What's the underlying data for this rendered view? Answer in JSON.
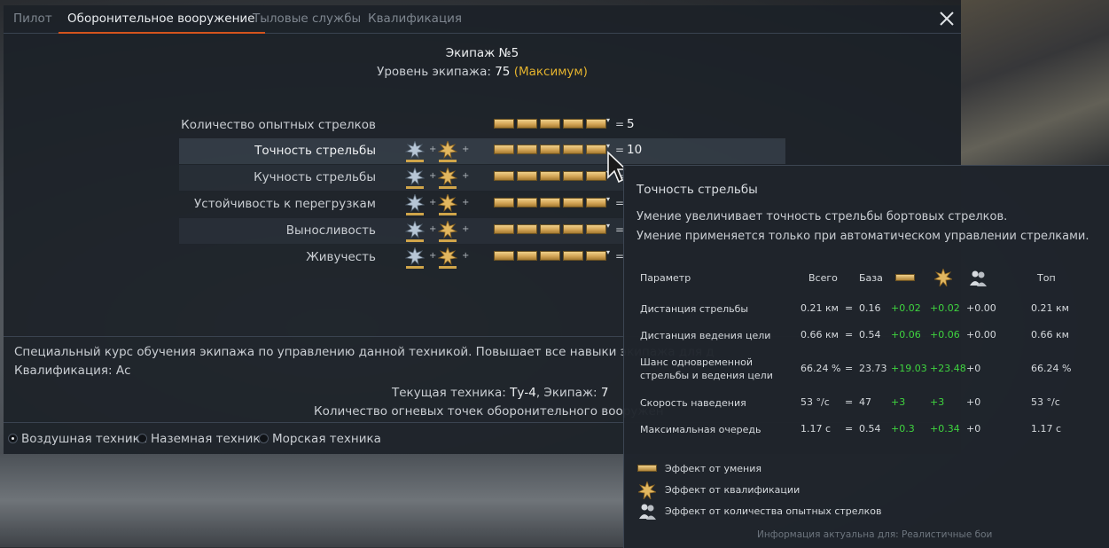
{
  "tabs": [
    {
      "label": "Пилот",
      "active": false
    },
    {
      "label": "Оборонительное вооружение",
      "active": true
    },
    {
      "label": "Тыловые службы",
      "active": false
    },
    {
      "label": "Квалификация",
      "active": false
    }
  ],
  "crew": {
    "title": "Экипаж №5",
    "level_prefix": "Уровень экипажа: ",
    "level_value": "75",
    "level_max": "(Максимум)"
  },
  "skills": [
    {
      "name": "Количество опытных стрелков",
      "value": "5",
      "badges": false,
      "filled": 5
    },
    {
      "name": "Точность стрельбы",
      "value": "10",
      "badges": true,
      "filled": 5
    },
    {
      "name": "Кучность стрельбы",
      "value": "",
      "badges": true,
      "filled": 5
    },
    {
      "name": "Устойчивость к перегрузкам",
      "value": "",
      "badges": true,
      "filled": 5
    },
    {
      "name": "Выносливость",
      "value": "",
      "badges": true,
      "filled": 5
    },
    {
      "name": "Живучесть",
      "value": "",
      "badges": true,
      "filled": 5
    }
  ],
  "description": {
    "line1": "Специальный курс обучения экипажа по управлению данной техникой. Повышает все навыки экипажа для д",
    "line2": "Квалификация: Ас",
    "current_prefix": "Текущая техника: ",
    "current_vehicle": "Ту-4",
    "current_sep": ", Экипаж: ",
    "current_crew": "7",
    "gun_points": "Количество огневых точек оборонительного вооружен"
  },
  "radios": [
    {
      "label": "Воздушная техника",
      "selected": true
    },
    {
      "label": "Наземная техника",
      "selected": false
    },
    {
      "label": "Морская техника",
      "selected": false
    }
  ],
  "tooltip": {
    "title": "Точность стрельбы",
    "desc1": "Умение увеличивает точность стрельбы бортовых стрелков.",
    "desc2": "Умение применяется только при автоматическом управлении стрелками.",
    "headers": {
      "param": "Параметр",
      "total": "Всего",
      "base": "База",
      "top": "Топ"
    },
    "rows": [
      {
        "name": "Дистанция стрельбы",
        "total": "0.21 км",
        "eq": "=",
        "base": "0.16",
        "skill": "+0.02",
        "qual": "+0.02",
        "gunners": "+0.00",
        "top": "0.21 км"
      },
      {
        "name": "Дистанция ведения цели",
        "total": "0.66 км",
        "eq": "=",
        "base": "0.54",
        "skill": "+0.06",
        "qual": "+0.06",
        "gunners": "+0.00",
        "top": "0.66 км"
      },
      {
        "name": "Шанс одновременной стрельбы и ведения цели",
        "total": "66.24 %",
        "eq": "=",
        "base": "23.73",
        "skill": "+19.03",
        "qual": "+23.48",
        "gunners": "+0",
        "top": "66.24 %"
      },
      {
        "name": "Скорость наведения",
        "total": "53 °/c",
        "eq": "=",
        "base": "47",
        "skill": "+3",
        "qual": "+3",
        "gunners": "+0",
        "top": "53 °/c"
      },
      {
        "name": "Максимальная очередь",
        "total": "1.17 с",
        "eq": "=",
        "base": "0.54",
        "skill": "+0.3",
        "qual": "+0.34",
        "gunners": "+0",
        "top": "1.17 с"
      }
    ],
    "legend": [
      {
        "icon": "skill-bar-icon",
        "label": "Эффект от умения"
      },
      {
        "icon": "qualification-star-icon",
        "label": "Эффект от квалификации"
      },
      {
        "icon": "gunners-icon",
        "label": "Эффект от количества опытных стрелков"
      }
    ],
    "footer": "Информация актуальна для: Реалистичные бои"
  },
  "colors": {
    "accent": "#d4541d",
    "gold": "#e3b22e",
    "green": "#3fd43f"
  }
}
